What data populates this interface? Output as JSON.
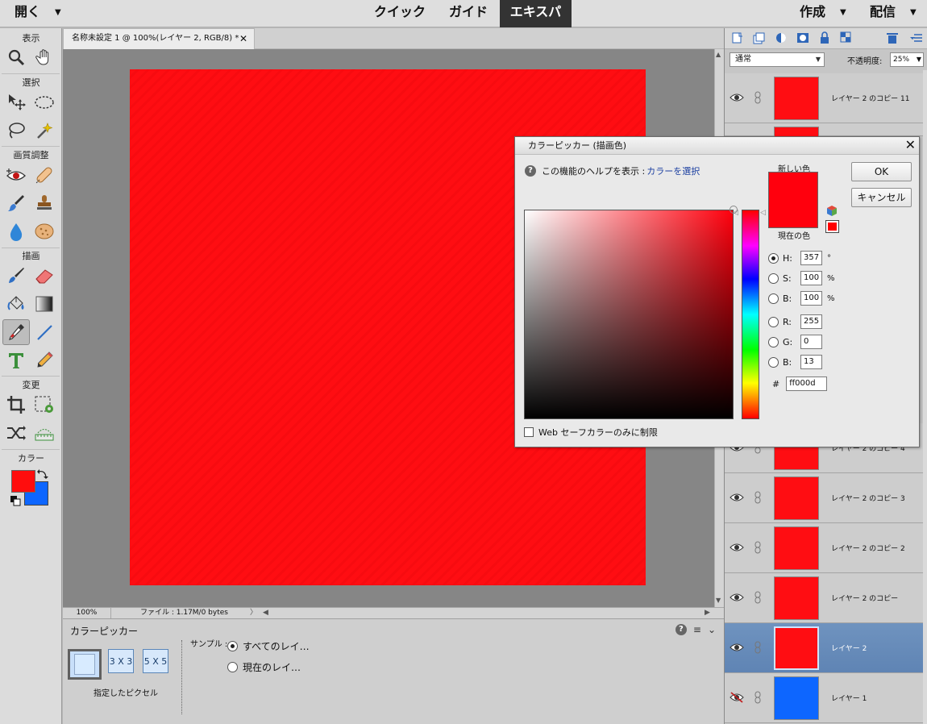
{
  "menubar": {
    "open": "開く",
    "modes": [
      "クイック",
      "ガイド",
      "エキスパート"
    ],
    "create": "作成",
    "share": "配信"
  },
  "toolbox": {
    "sections": {
      "view": "表示",
      "select": "選択",
      "enhance": "画質調整",
      "draw": "描画",
      "modify": "変更",
      "color": "カラー"
    },
    "foreground_color": "#ff0d0d",
    "background_color": "#0d66ff",
    "active_tool": "eyedropper"
  },
  "document": {
    "tab_title": "名称未設定 1 @ 100%(レイヤー 2, RGB/8) *",
    "canvas_color": "#ff0d12",
    "zoom": "100%",
    "file_info": "ファイル : 1.17M/0 bytes"
  },
  "tool_options": {
    "title": "カラーピッカー",
    "sample_sizes": [
      "",
      "3 X 3",
      "5 X 5"
    ],
    "caption": "指定したピクセル",
    "sample_label": "サンプル :",
    "radio_all": "すべてのレイ…",
    "radio_current": "現在のレイ…"
  },
  "layers_panel": {
    "blend_mode": "通常",
    "opacity_label": "不透明度:",
    "opacity_value": "25%",
    "layers": [
      {
        "name": "レイヤー 2 のコピー 11",
        "color": "#ff0d12",
        "visible": true,
        "selected": false
      },
      {
        "name": "レイヤー 2 のコピー 4",
        "color": "#ff0d12",
        "visible": true,
        "selected": false
      },
      {
        "name": "レイヤー 2 のコピー 3",
        "color": "#ff0d12",
        "visible": true,
        "selected": false
      },
      {
        "name": "レイヤー 2 のコピー 2",
        "color": "#ff0d12",
        "visible": true,
        "selected": false
      },
      {
        "name": "レイヤー 2 のコピー",
        "color": "#ff0d12",
        "visible": true,
        "selected": false
      },
      {
        "name": "レイヤー 2",
        "color": "#ff0d12",
        "visible": true,
        "selected": true
      },
      {
        "name": "レイヤー 1",
        "color": "#0d66ff",
        "visible": false,
        "selected": false
      }
    ]
  },
  "color_picker": {
    "title": "カラーピッカー (描画色)",
    "help_text": "この機能のヘルプを表示 :",
    "help_link": "カラーを選択",
    "new_label": "新しい色",
    "current_label": "現在の色",
    "ok": "OK",
    "cancel": "キャンセル",
    "fields": {
      "H": "357",
      "H_unit": "°",
      "S": "100",
      "S_unit": "%",
      "B": "100",
      "B_unit": "%",
      "R": "255",
      "G": "0",
      "Bl": "13"
    },
    "labels": {
      "H": "H:",
      "S": "S:",
      "B": "B:",
      "R": "R:",
      "G": "G:",
      "Bl": "B:"
    },
    "hex_label": "#",
    "hex": "ff000d",
    "websafe_label": "Web セーフカラーのみに制限",
    "selected_color": "#ff000d"
  }
}
